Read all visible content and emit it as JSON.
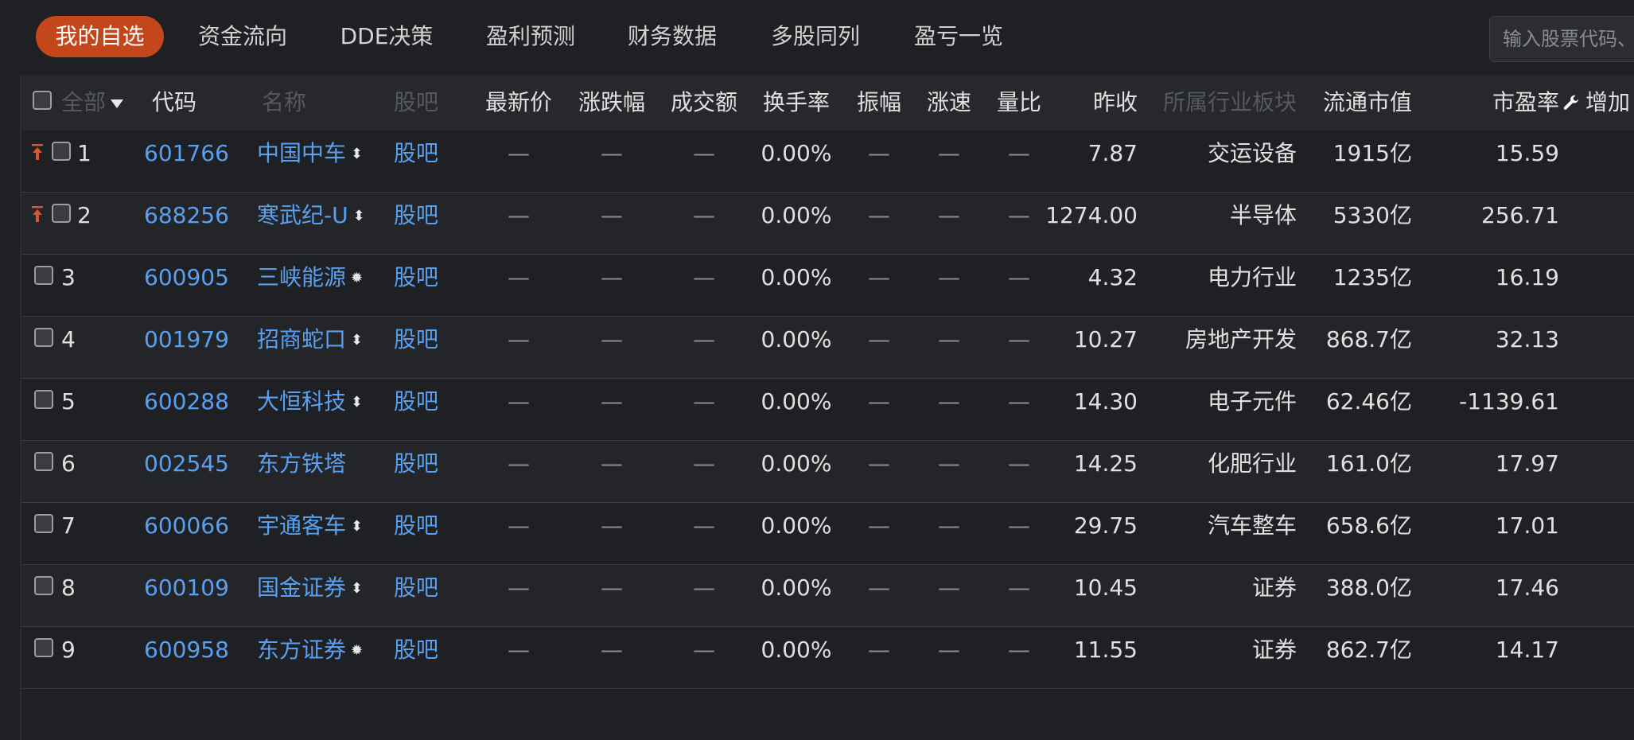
{
  "tabs": [
    {
      "label": "我的自选",
      "active": true
    },
    {
      "label": "资金流向"
    },
    {
      "label": "DDE决策"
    },
    {
      "label": "盈利预测"
    },
    {
      "label": "财务数据"
    },
    {
      "label": "多股同列"
    },
    {
      "label": "盈亏一览"
    }
  ],
  "search": {
    "placeholder": "输入股票代码、名称"
  },
  "colors": {
    "accent": "#c4471c",
    "link": "#5aa0f0",
    "pin": "#e0542a"
  },
  "table": {
    "headers": {
      "all": "全部",
      "code": "代码",
      "name": "名称",
      "guba": "股吧",
      "latest": "最新价",
      "change_pct": "涨跌幅",
      "volume": "成交额",
      "turnover": "换手率",
      "amplitude": "振幅",
      "speed": "涨速",
      "vol_ratio": "量比",
      "prev_close": "昨收",
      "industry": "所属行业板块",
      "float_cap": "流通市值",
      "pe": "市盈率",
      "add": "增加"
    },
    "rows": [
      {
        "idx": "1",
        "pinned": true,
        "code": "601766",
        "name": "中国中车",
        "icon": "sort-icon",
        "guba": "股吧",
        "latest": "—",
        "change_pct": "—",
        "volume": "—",
        "turnover": "0.00%",
        "amplitude": "—",
        "speed": "—",
        "vol_ratio": "—",
        "prev_close": "7.87",
        "industry": "交运设备",
        "float_cap": "1915亿",
        "pe": "15.59"
      },
      {
        "idx": "2",
        "pinned": true,
        "code": "688256",
        "name": "寒武纪-U",
        "icon": "sort-icon",
        "guba": "股吧",
        "latest": "—",
        "change_pct": "—",
        "volume": "—",
        "turnover": "0.00%",
        "amplitude": "—",
        "speed": "—",
        "vol_ratio": "—",
        "prev_close": "1274.00",
        "industry": "半导体",
        "float_cap": "5330亿",
        "pe": "256.71"
      },
      {
        "idx": "3",
        "pinned": false,
        "code": "600905",
        "name": "三峡能源",
        "icon": "star-icon",
        "guba": "股吧",
        "latest": "—",
        "change_pct": "—",
        "volume": "—",
        "turnover": "0.00%",
        "amplitude": "—",
        "speed": "—",
        "vol_ratio": "—",
        "prev_close": "4.32",
        "industry": "电力行业",
        "float_cap": "1235亿",
        "pe": "16.19"
      },
      {
        "idx": "4",
        "pinned": false,
        "code": "001979",
        "name": "招商蛇口",
        "icon": "sort-icon",
        "guba": "股吧",
        "latest": "—",
        "change_pct": "—",
        "volume": "—",
        "turnover": "0.00%",
        "amplitude": "—",
        "speed": "—",
        "vol_ratio": "—",
        "prev_close": "10.27",
        "industry": "房地产开发",
        "float_cap": "868.7亿",
        "pe": "32.13"
      },
      {
        "idx": "5",
        "pinned": false,
        "code": "600288",
        "name": "大恒科技",
        "icon": "sort-icon",
        "guba": "股吧",
        "latest": "—",
        "change_pct": "—",
        "volume": "—",
        "turnover": "0.00%",
        "amplitude": "—",
        "speed": "—",
        "vol_ratio": "—",
        "prev_close": "14.30",
        "industry": "电子元件",
        "float_cap": "62.46亿",
        "pe": "-1139.61"
      },
      {
        "idx": "6",
        "pinned": false,
        "code": "002545",
        "name": "东方铁塔",
        "icon": "",
        "guba": "股吧",
        "latest": "—",
        "change_pct": "—",
        "volume": "—",
        "turnover": "0.00%",
        "amplitude": "—",
        "speed": "—",
        "vol_ratio": "—",
        "prev_close": "14.25",
        "industry": "化肥行业",
        "float_cap": "161.0亿",
        "pe": "17.97"
      },
      {
        "idx": "7",
        "pinned": false,
        "code": "600066",
        "name": "宇通客车",
        "icon": "sort-icon",
        "guba": "股吧",
        "latest": "—",
        "change_pct": "—",
        "volume": "—",
        "turnover": "0.00%",
        "amplitude": "—",
        "speed": "—",
        "vol_ratio": "—",
        "prev_close": "29.75",
        "industry": "汽车整车",
        "float_cap": "658.6亿",
        "pe": "17.01"
      },
      {
        "idx": "8",
        "pinned": false,
        "code": "600109",
        "name": "国金证券",
        "icon": "sort-icon",
        "guba": "股吧",
        "latest": "—",
        "change_pct": "—",
        "volume": "—",
        "turnover": "0.00%",
        "amplitude": "—",
        "speed": "—",
        "vol_ratio": "—",
        "prev_close": "10.45",
        "industry": "证券",
        "float_cap": "388.0亿",
        "pe": "17.46"
      },
      {
        "idx": "9",
        "pinned": false,
        "code": "600958",
        "name": "东方证券",
        "icon": "star-icon",
        "guba": "股吧",
        "latest": "—",
        "change_pct": "—",
        "volume": "—",
        "turnover": "0.00%",
        "amplitude": "—",
        "speed": "—",
        "vol_ratio": "—",
        "prev_close": "11.55",
        "industry": "证券",
        "float_cap": "862.7亿",
        "pe": "14.17"
      }
    ]
  }
}
